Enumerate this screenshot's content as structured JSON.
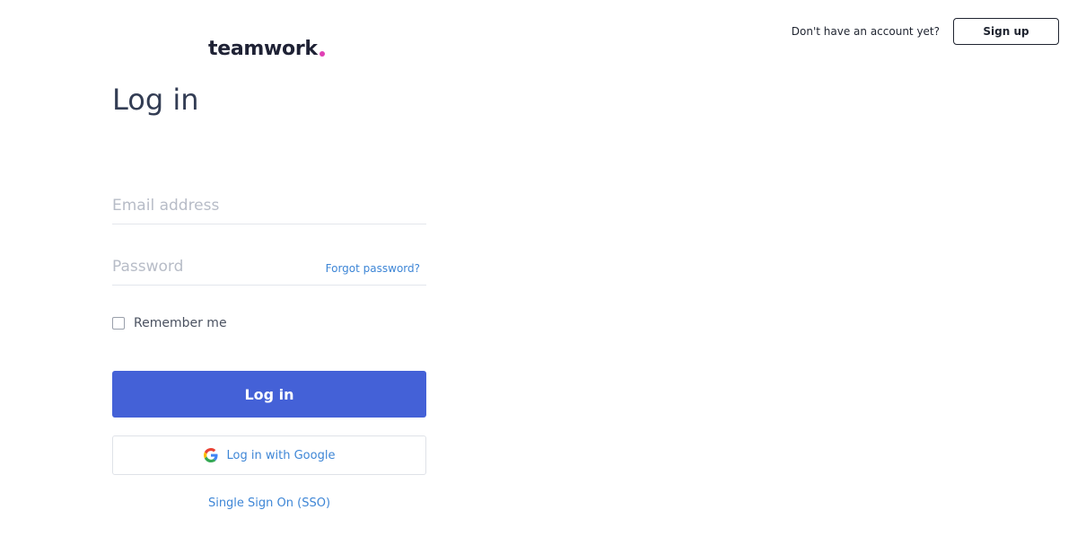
{
  "header": {
    "signup_prompt": "Don't have an account yet?",
    "signup_label": "Sign up"
  },
  "logo": {
    "text": "teamwork",
    "dot_color": "#e040b4"
  },
  "title": "Log in",
  "form": {
    "email_placeholder": "Email address",
    "email_value": "",
    "password_placeholder": "Password",
    "password_value": "",
    "forgot_label": "Forgot password?",
    "remember_label": "Remember me",
    "remember_checked": false,
    "login_label": "Log in",
    "google_label": "Log in with Google",
    "google_icon": "google-icon",
    "sso_label": "Single Sign On (SSO)"
  },
  "colors": {
    "primary": "#4461d7",
    "link": "#3e86d6",
    "heading": "#333d54"
  }
}
